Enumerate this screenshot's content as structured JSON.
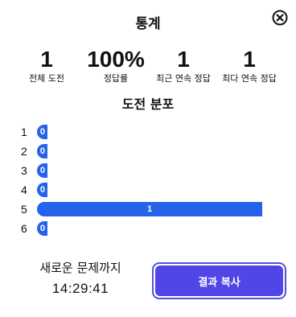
{
  "modal": {
    "title": "통계",
    "close_icon": "close-circle-icon"
  },
  "stats": [
    {
      "value": "1",
      "label": "전체 도전"
    },
    {
      "value": "100%",
      "label": "정답률"
    },
    {
      "value": "1",
      "label": "최근 연속 정답"
    },
    {
      "value": "1",
      "label": "최다 연속 정답"
    }
  ],
  "distribution": {
    "title": "도전 분포",
    "bar_color": "#2563eb",
    "rows": [
      {
        "guess": "1",
        "count": 0
      },
      {
        "guess": "2",
        "count": 0
      },
      {
        "guess": "3",
        "count": 0
      },
      {
        "guess": "4",
        "count": 0
      },
      {
        "guess": "5",
        "count": 1
      },
      {
        "guess": "6",
        "count": 0
      }
    ]
  },
  "footer": {
    "next_label": "새로운 문제까지",
    "countdown": "14:29:41",
    "share_label": "결과 복사",
    "share_color": "#4f46e5"
  }
}
